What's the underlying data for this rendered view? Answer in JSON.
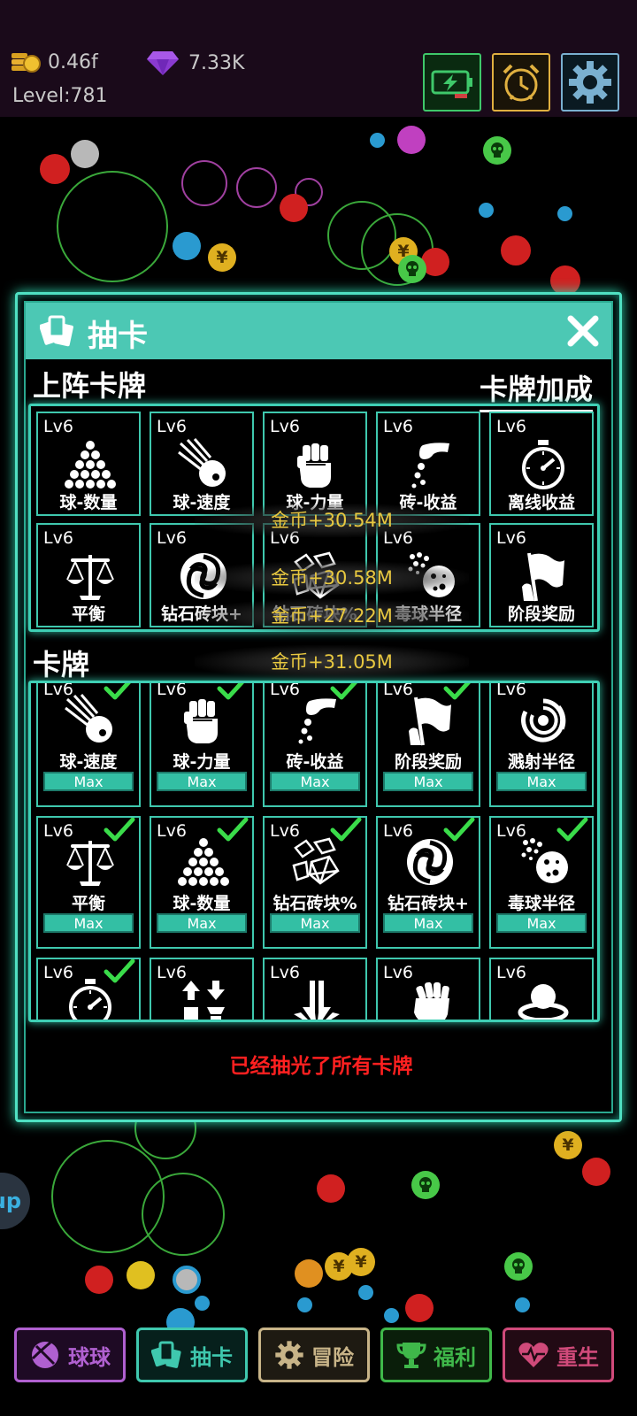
{
  "top_bar": {
    "coins": "0.46f",
    "gems": "7.33K",
    "level": "Level:781",
    "buttons": [
      {
        "icon": "power-saving-icon",
        "color": "#3fc86a"
      },
      {
        "icon": "alarm-clock-icon",
        "color": "#e0b040"
      },
      {
        "icon": "gear-icon",
        "color": "#7ab0d0"
      }
    ]
  },
  "panel": {
    "title": "抽卡",
    "active_section_title": "上阵卡牌",
    "bonus_link": "卡牌加成",
    "collection_section_title": "卡牌",
    "empty_message": "已经抽光了所有卡牌"
  },
  "active_cards": [
    {
      "level": "Lv6",
      "label": "球-数量",
      "icon": "ball-pyramid-icon"
    },
    {
      "level": "Lv6",
      "label": "球-速度",
      "icon": "fast-ball-icon"
    },
    {
      "level": "Lv6",
      "label": "球-力量",
      "icon": "fist-icon"
    },
    {
      "level": "Lv6",
      "label": "砖-收益",
      "icon": "coin-hand-icon"
    },
    {
      "level": "Lv6",
      "label": "离线收益",
      "icon": "stopwatch-icon"
    },
    {
      "level": "Lv6",
      "label": "平衡",
      "icon": "scales-icon"
    },
    {
      "level": "Lv6",
      "label": "钻石砖块+",
      "icon": "swirl-icon"
    },
    {
      "level": "Lv6",
      "label": "钻石砖块%",
      "icon": "diamond-shards-icon"
    },
    {
      "level": "Lv6",
      "label": "毒球半径",
      "icon": "poison-ball-icon"
    },
    {
      "level": "Lv6",
      "label": "阶段奖励",
      "icon": "flag-icon"
    }
  ],
  "collection_cards": [
    {
      "level": "Lv6",
      "label": "球-速度",
      "icon": "fast-ball-icon",
      "max": "Max",
      "checked": true
    },
    {
      "level": "Lv6",
      "label": "球-力量",
      "icon": "fist-icon",
      "max": "Max",
      "checked": true
    },
    {
      "level": "Lv6",
      "label": "砖-收益",
      "icon": "coin-hand-icon",
      "max": "Max",
      "checked": true
    },
    {
      "level": "Lv6",
      "label": "阶段奖励",
      "icon": "flag-icon",
      "max": "Max",
      "checked": true
    },
    {
      "level": "Lv6",
      "label": "溅射半径",
      "icon": "splash-rings-icon",
      "max": "Max",
      "checked": false
    },
    {
      "level": "Lv6",
      "label": "平衡",
      "icon": "scales-icon",
      "max": "Max",
      "checked": true
    },
    {
      "level": "Lv6",
      "label": "球-数量",
      "icon": "ball-pyramid-icon",
      "max": "Max",
      "checked": true
    },
    {
      "level": "Lv6",
      "label": "钻石砖块%",
      "icon": "diamond-shards-icon",
      "max": "Max",
      "checked": true
    },
    {
      "level": "Lv6",
      "label": "钻石砖块+",
      "icon": "swirl-icon",
      "max": "Max",
      "checked": true
    },
    {
      "level": "Lv6",
      "label": "毒球半径",
      "icon": "poison-ball-icon",
      "max": "Max",
      "checked": true
    },
    {
      "level": "Lv6",
      "icon": "stopwatch-icon",
      "checked": true
    },
    {
      "level": "Lv6",
      "icon": "arrows-icon",
      "checked": false
    },
    {
      "level": "Lv6",
      "icon": "downward-arrows-icon",
      "checked": false
    },
    {
      "level": "Lv6",
      "icon": "raised-fist-icon",
      "checked": false
    },
    {
      "level": "Lv6",
      "icon": "orbit-ball-icon",
      "checked": false
    }
  ],
  "floating_rewards": [
    "金币+30.54M",
    "金币+30.58M",
    "金币+27.22M",
    "金币+31.05M"
  ],
  "bottom_nav": [
    {
      "label": "球球",
      "icon": "ball-icon",
      "color": "#b060d0"
    },
    {
      "label": "抽卡",
      "icon": "cards-icon",
      "color": "#3fc8ae"
    },
    {
      "label": "冒险",
      "icon": "gear-icon",
      "color": "#c8b488"
    },
    {
      "label": "福利",
      "icon": "trophy-icon",
      "color": "#3fb84a"
    },
    {
      "label": "重生",
      "icon": "heart-icon",
      "color": "#d04a7a"
    }
  ],
  "background": {
    "coin_symbol": "¥",
    "side_bubble": "up"
  }
}
